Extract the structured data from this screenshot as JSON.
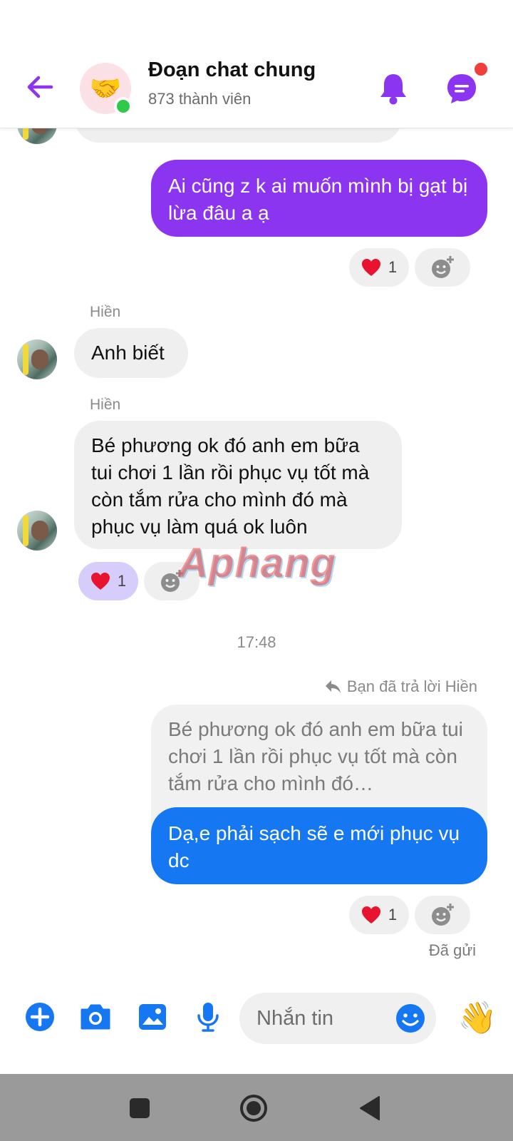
{
  "header": {
    "title": "Đoạn chat chung",
    "subtitle": "873 thành viên",
    "group_avatar_emoji": "🤝"
  },
  "messages": {
    "m1": {
      "text": "Ai cũng z k ai muốn mình bị gạt bị lừa đâu a ạ",
      "reaction_count": "1"
    },
    "m2": {
      "sender": "Hiền",
      "text": "Anh biết"
    },
    "m3": {
      "sender": "Hiền",
      "text": "Bé phương ok đó anh em bữa tui chơi 1 lần rồi phục vụ tốt mà còn tắm rửa cho mình đó mà phục vụ làm quá ok luôn",
      "reaction_count": "1"
    },
    "timestamp": "17:48",
    "reply_note": "Bạn đã trả lời Hiền",
    "quoted_text": "Bé phương ok đó anh em bữa tui chơi 1 lần rồi phục vụ tốt mà còn tắm rửa cho mình đó…",
    "m4": {
      "text": "Dạ,e phải sạch sẽ e mới phục vụ dc",
      "reaction_count": "1"
    },
    "sent_status": "Đã gửi"
  },
  "watermark": "Aphang",
  "composer": {
    "placeholder": "Nhắn tin",
    "wave_emoji": "👋"
  },
  "colors": {
    "accent_purple": "#8b35f0",
    "accent_blue": "#1677f2",
    "online": "#31c94a",
    "notification": "#f23d3d"
  },
  "icons": [
    "back-arrow-icon",
    "bell-icon",
    "chat-bubble-icon",
    "heart-icon",
    "add-reaction-icon",
    "reply-arrow-icon",
    "plus-icon",
    "camera-icon",
    "image-icon",
    "microphone-icon",
    "emoji-icon",
    "wave-icon",
    "nav-square-icon",
    "nav-circle-icon",
    "nav-triangle-icon"
  ]
}
